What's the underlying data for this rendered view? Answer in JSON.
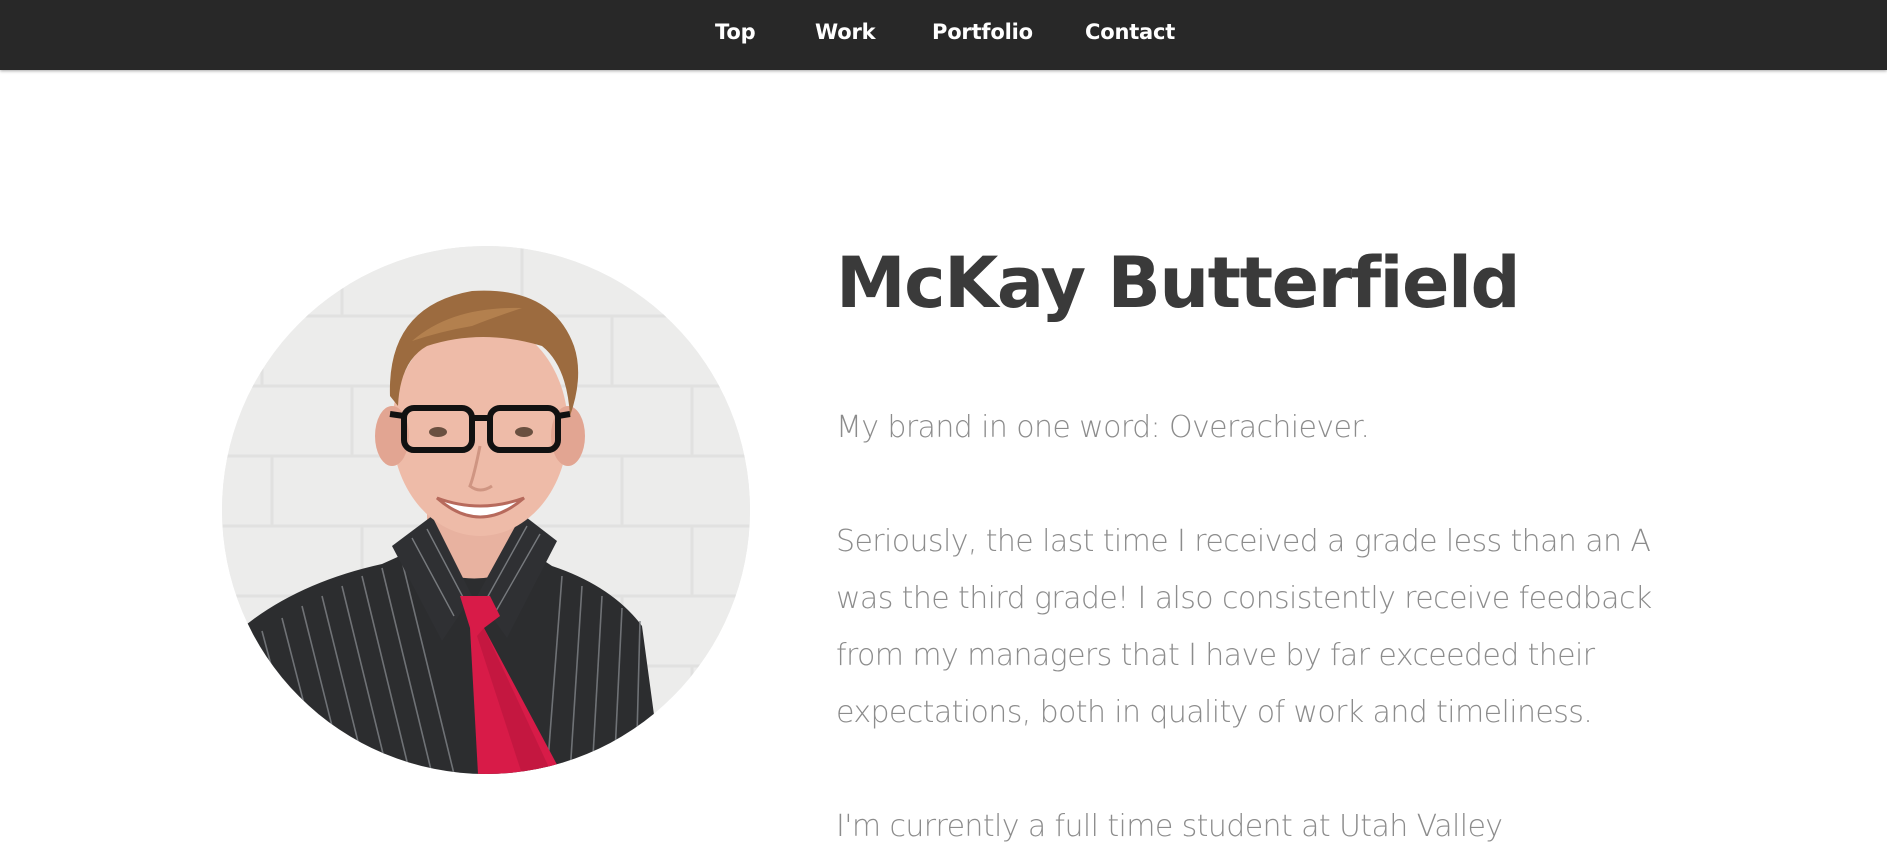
{
  "nav": {
    "items": [
      {
        "label": "Top"
      },
      {
        "label": "Work"
      },
      {
        "label": "Portfolio"
      },
      {
        "label": "Contact"
      }
    ]
  },
  "profile": {
    "name": "McKay Butterfield",
    "photo_alt": "McKay Butterfield portrait"
  },
  "bio": {
    "p1": "My brand in one word: Overachiever.",
    "p2": "Seriously, the last time I received a grade less than an A was the third grade! I also consistently receive feedback from my managers that I have by far exceeded their expectations, both in quality of work and timeliness.",
    "p3": "I'm currently a full time student at Utah Valley"
  },
  "colors": {
    "navbar_bg": "#282828",
    "nav_text": "#ffffff",
    "heading": "#3a3a3a",
    "body_text": "#8c8c8c",
    "tie": "#d81b48"
  }
}
